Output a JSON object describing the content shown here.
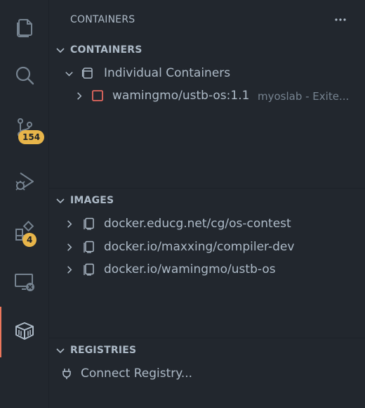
{
  "activity_bar": {
    "items": [
      {
        "icon": "explorer-icon"
      },
      {
        "icon": "search-icon"
      },
      {
        "icon": "source-control-icon",
        "badge": "154"
      },
      {
        "icon": "run-debug-icon"
      },
      {
        "icon": "extensions-icon",
        "badge": "4"
      },
      {
        "icon": "remote-explorer-icon"
      },
      {
        "icon": "docker-icon",
        "active": true
      }
    ],
    "active_indicator_color": "#ec775c",
    "badge_color": "#e8b54a"
  },
  "sidebar": {
    "view_title": "CONTAINERS",
    "more_actions": "···",
    "sections": {
      "containers": {
        "label": "CONTAINERS",
        "group_label": "Individual Containers",
        "items": [
          {
            "name": "wamingmo/ustb-os:1.1",
            "description": "myoslab - Exite..."
          }
        ],
        "stopped_color": "#e5685f"
      },
      "images": {
        "label": "IMAGES",
        "items": [
          {
            "name": "docker.educg.net/cg/os-contest"
          },
          {
            "name": "docker.io/maxxing/compiler-dev"
          },
          {
            "name": "docker.io/wamingmo/ustb-os"
          }
        ]
      },
      "registries": {
        "label": "REGISTRIES",
        "connect_label": "Connect Registry..."
      }
    }
  }
}
